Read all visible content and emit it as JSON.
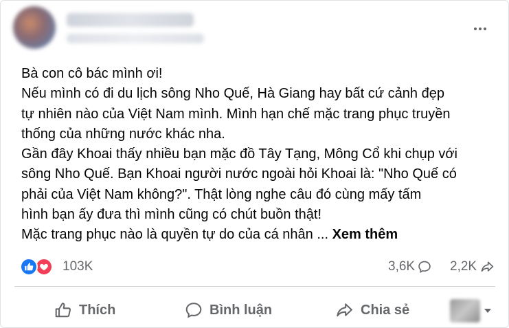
{
  "post": {
    "author_blurred": true,
    "more_icon": "more-horizontal-icon",
    "lines": [
      "Bà con cô bác mình ơi!",
      "Nếu mình có đi du lịch sông Nho Quế, Hà Giang hay bất cứ cảnh đẹp",
      "tự nhiên nào của Việt Nam mình. Mình hạn chế mặc trang phục truyền",
      "thống của những nước khác nha.",
      "Gần đây Khoai thấy nhiều bạn mặc đồ Tây Tạng, Mông Cổ khi chụp với",
      "sông Nho Quế. Bạn Khoai người nước ngoài hỏi Khoai là: \"Nho Quế có",
      "phải của Việt Nam không?\". Thật lòng nghe câu đó cùng mấy tấm",
      "hình bạn ấy đưa thì mình cũng có chút buồn thật!"
    ],
    "last_line": "Mặc trang phục nào là quyền tự do của cá nhân ... ",
    "see_more": "Xem thêm"
  },
  "stats": {
    "reactions": "103K",
    "comments": "3,6K",
    "shares": "2,2K"
  },
  "actions": {
    "like": "Thích",
    "comment": "Bình luận",
    "share": "Chia sẻ"
  },
  "colors": {
    "like_blue": "#1877f2",
    "love_red": "#f33e58",
    "secondary_text": "#65676b"
  }
}
